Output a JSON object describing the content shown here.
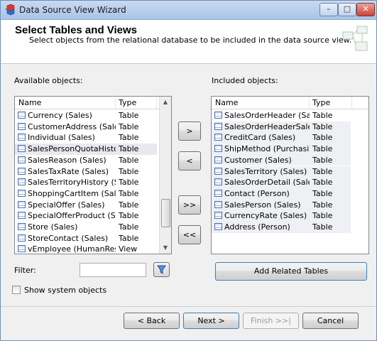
{
  "window": {
    "title": "Data Source View Wizard",
    "minimize_glyph": "–",
    "maximize_glyph": "□",
    "close_glyph": "✕"
  },
  "header": {
    "title": "Select Tables and Views",
    "subtitle": "Select objects from the relational database to be included in the data source view."
  },
  "available": {
    "label": "Available objects:",
    "col_name": "Name",
    "col_type": "Type",
    "rows": [
      {
        "name": "Currency (Sales)",
        "type": "Table"
      },
      {
        "name": "CustomerAddress (Sales)",
        "type": "Table"
      },
      {
        "name": "Individual (Sales)",
        "type": "Table"
      },
      {
        "name": "SalesPersonQuotaHistory ...",
        "type": "Table"
      },
      {
        "name": "SalesReason (Sales)",
        "type": "Table"
      },
      {
        "name": "SalesTaxRate (Sales)",
        "type": "Table"
      },
      {
        "name": "SalesTerritoryHistory (Sales)",
        "type": "Table"
      },
      {
        "name": "ShoppingCartItem (Sales)",
        "type": "Table"
      },
      {
        "name": "SpecialOffer (Sales)",
        "type": "Table"
      },
      {
        "name": "SpecialOfferProduct (Sales)",
        "type": "Table"
      },
      {
        "name": "Store (Sales)",
        "type": "Table"
      },
      {
        "name": "StoreContact (Sales)",
        "type": "Table"
      },
      {
        "name": "vEmployee (HumanResou...",
        "type": "View"
      }
    ],
    "selected_row": "SalesPersonQuotaHistory ...",
    "scroll_position": 0.86
  },
  "included": {
    "label": "Included objects:",
    "col_name": "Name",
    "col_type": "Type",
    "rows": [
      {
        "name": "SalesOrderHeader (Sales)",
        "type": "Table"
      },
      {
        "name": "SalesOrderHeaderSalesRe...",
        "type": "Table"
      },
      {
        "name": "CreditCard (Sales)",
        "type": "Table"
      },
      {
        "name": "ShipMethod (Purchasing)",
        "type": "Table"
      },
      {
        "name": "Customer (Sales)",
        "type": "Table"
      },
      {
        "name": "SalesTerritory (Sales)",
        "type": "Table"
      },
      {
        "name": "SalesOrderDetail (Sales)",
        "type": "Table"
      },
      {
        "name": "Contact (Person)",
        "type": "Table"
      },
      {
        "name": "SalesPerson (Sales)",
        "type": "Table"
      },
      {
        "name": "CurrencyRate (Sales)",
        "type": "Table"
      },
      {
        "name": "Address (Person)",
        "type": "Table"
      }
    ]
  },
  "move_buttons": {
    "add": ">",
    "remove": "<",
    "add_all": ">>",
    "remove_all": "<<"
  },
  "filter": {
    "label": "Filter:",
    "value": "",
    "button_icon": "funnel-icon"
  },
  "show_system": {
    "label": "Show system objects",
    "checked": false
  },
  "add_related_label": "Add Related Tables",
  "footer": {
    "back": "< Back",
    "next": "Next >",
    "finish": "Finish >>|",
    "cancel": "Cancel"
  },
  "colors": {
    "accent_border": "#3c7fb1",
    "selection": "#e8e8ee",
    "icon_blue": "#4a6ea9"
  }
}
